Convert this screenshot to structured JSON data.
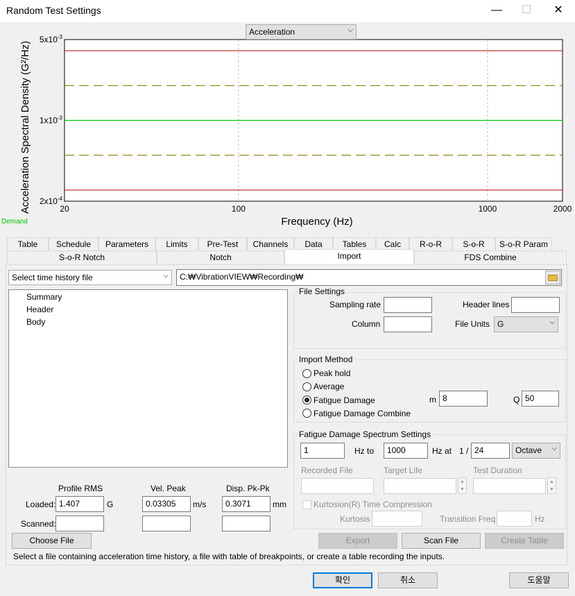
{
  "window": {
    "title": "Random Test Settings",
    "minimize": "—",
    "maximize": "☐",
    "close": "✕"
  },
  "chart_data": {
    "type": "line",
    "xlabel": "Frequency (Hz)",
    "ylabel": "Acceleration Spectral Density (G²/Hz)",
    "xscale": "log",
    "yscale": "log",
    "xlim": [
      20,
      2000
    ],
    "ylim": [
      0.0002,
      0.005
    ],
    "x_ticks": [
      20,
      100,
      1000,
      2000
    ],
    "x_tick_labels": [
      "20",
      "100",
      "1000",
      "2000"
    ],
    "y_ticks": [
      0.0002,
      0.001,
      0.005
    ],
    "y_tick_mant": [
      "2x10",
      "1x10",
      "5x10"
    ],
    "y_tick_exp": [
      "-4",
      "-3",
      "-3"
    ],
    "series": [
      {
        "role": "upper-abort",
        "x": [
          20,
          2000
        ],
        "y": [
          0.004,
          0.004
        ],
        "color": "#c83232",
        "dash": false
      },
      {
        "role": "upper-alarm",
        "x": [
          20,
          2000
        ],
        "y": [
          0.002,
          0.002
        ],
        "color": "#8a7a00",
        "dash": true
      },
      {
        "name": "Demand",
        "x": [
          20,
          2000
        ],
        "y": [
          0.001,
          0.001
        ],
        "color": "#00c800",
        "dash": false
      },
      {
        "role": "lower-alarm",
        "x": [
          20,
          2000
        ],
        "y": [
          0.0005,
          0.0005
        ],
        "color": "#8a7a00",
        "dash": true
      },
      {
        "role": "lower-abort",
        "x": [
          20,
          2000
        ],
        "y": [
          0.00025,
          0.00025
        ],
        "color": "#c83232",
        "dash": false
      }
    ],
    "grid": true,
    "legend": "bottom-left"
  },
  "chart_selector": {
    "value": "Acceleration"
  },
  "legend_text": "Demand",
  "tabs_row1": [
    "Table",
    "Schedule",
    "Parameters",
    "Limits",
    "Pre-Test",
    "Channels",
    "Data",
    "Tables",
    "Calc",
    "R-o-R",
    "S-o-R",
    "S-o-R Param"
  ],
  "tabs_row2": [
    "S-o-R Notch",
    "Notch",
    "Import",
    "FDS Combine"
  ],
  "import": {
    "source_select": "Select time history file",
    "path": "C:₩VibrationVIEW₩Recording₩",
    "tree": [
      "Summary",
      "Header",
      "Body"
    ],
    "file_settings": {
      "title": "File Settings",
      "sampling_rate_label": "Sampling rate",
      "sampling_rate": "",
      "header_lines_label": "Header lines",
      "header_lines": "",
      "column_label": "Column",
      "column": "",
      "file_units_label": "File Units",
      "file_units": "G"
    },
    "import_method": {
      "title": "Import Method",
      "options": [
        "Peak hold",
        "Average",
        "Fatigue Damage",
        "Fatigue Damage Combine"
      ],
      "selected": 2,
      "m_label": "m",
      "m": "8",
      "q_label": "Q",
      "q": "50"
    },
    "fds": {
      "title": "Fatigue Damage Spectrum Settings",
      "from": "1",
      "to_label": "Hz to",
      "to": "1000",
      "at_label": "Hz at",
      "one_over": "1 /",
      "frac": "24",
      "octave": "Octave",
      "recorded_file_label": "Recorded File",
      "target_life_label": "Target Life",
      "test_duration_label": "Test Duration",
      "kurtosion_label": "Kurtosion(R) Time Compression",
      "kurtosis_label": "Kurtosis",
      "transition_label": "Transition Freq",
      "hz": "Hz"
    },
    "results": {
      "profile_rms": "Profile RMS",
      "vel_peak": "Vel. Peak",
      "disp": "Disp. Pk-Pk",
      "loaded_label": "Loaded:",
      "scanned_label": "Scanned:",
      "loaded_rms": "1.407",
      "unit_g": "G",
      "loaded_vel": "0.03305",
      "unit_vel": "m/s",
      "loaded_disp": "0.3071",
      "unit_disp": "mm"
    },
    "buttons": {
      "choose": "Choose File",
      "export": "Export",
      "scan": "Scan File",
      "create": "Create Table"
    },
    "hint": "Select a file containing acceleration time history, a file with table of breakpoints, or create a table recording the inputs."
  },
  "footer": {
    "ok": "확인",
    "cancel": "취소",
    "help": "도움말"
  },
  "colors": {
    "accent": "#0078d7",
    "window_bg": "#f0f0f0"
  }
}
